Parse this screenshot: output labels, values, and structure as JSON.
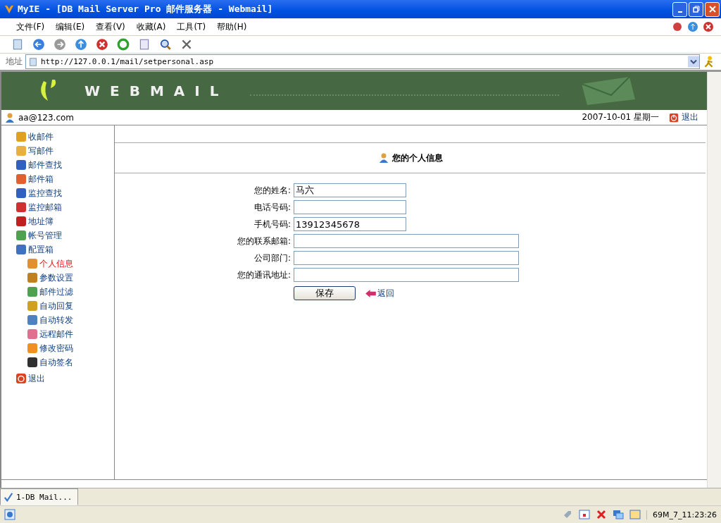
{
  "window": {
    "title": "MyIE - [DB Mail Server Pro 邮件服务器 - Webmail]"
  },
  "menu": [
    "文件(F)",
    "编辑(E)",
    "查看(V)",
    "收藏(A)",
    "工具(T)",
    "帮助(H)"
  ],
  "address_bar": {
    "label": "地址",
    "url": "http://127.0.0.1/mail/setpersonal.asp"
  },
  "banner": {
    "logo_text": "WEBMAIL"
  },
  "user_bar": {
    "user": "aa@123.com",
    "date": "2007-10-01 星期一",
    "logout": "退出"
  },
  "sidebar": {
    "items": [
      {
        "label": "收邮件",
        "kind": "item",
        "selected": false
      },
      {
        "label": "写邮件",
        "kind": "item",
        "selected": false
      },
      {
        "label": "邮件查找",
        "kind": "item",
        "selected": false
      },
      {
        "label": "邮件箱",
        "kind": "item",
        "selected": false
      },
      {
        "label": "监控查找",
        "kind": "item",
        "selected": false
      },
      {
        "label": "监控邮箱",
        "kind": "item",
        "selected": false
      },
      {
        "label": "地址簿",
        "kind": "item",
        "selected": false
      },
      {
        "label": "帐号管理",
        "kind": "item",
        "selected": false
      },
      {
        "label": "配置箱",
        "kind": "item",
        "selected": false
      },
      {
        "label": "个人信息",
        "kind": "sub",
        "selected": true
      },
      {
        "label": "参数设置",
        "kind": "sub",
        "selected": false
      },
      {
        "label": "邮件过滤",
        "kind": "sub",
        "selected": false
      },
      {
        "label": "自动回复",
        "kind": "sub",
        "selected": false
      },
      {
        "label": "自动转发",
        "kind": "sub",
        "selected": false
      },
      {
        "label": "远程邮件",
        "kind": "sub",
        "selected": false
      },
      {
        "label": "修改密码",
        "kind": "sub",
        "selected": false
      },
      {
        "label": "自动签名",
        "kind": "sub",
        "selected": false
      },
      {
        "label": "退出",
        "kind": "exit",
        "selected": false
      }
    ]
  },
  "form": {
    "title": "您的个人信息",
    "fields": [
      {
        "label": "您的姓名:",
        "value": "马六",
        "kind": "short"
      },
      {
        "label": "电话号码:",
        "kind": "short"
      },
      {
        "label": "手机号码:",
        "value": "13912345678",
        "kind": "short"
      },
      {
        "label": "您的联系邮箱:",
        "kind": "long"
      },
      {
        "label": "公司部门:",
        "kind": "long"
      },
      {
        "label": "您的通讯地址:",
        "kind": "long"
      }
    ],
    "save_button": "保存",
    "back_link": "返回"
  },
  "tab_bar": {
    "tabs": [
      {
        "label": "1-DB Mail...",
        "selected": true
      }
    ]
  },
  "status_bar": {
    "memory": "69M_7_11:23:26"
  }
}
